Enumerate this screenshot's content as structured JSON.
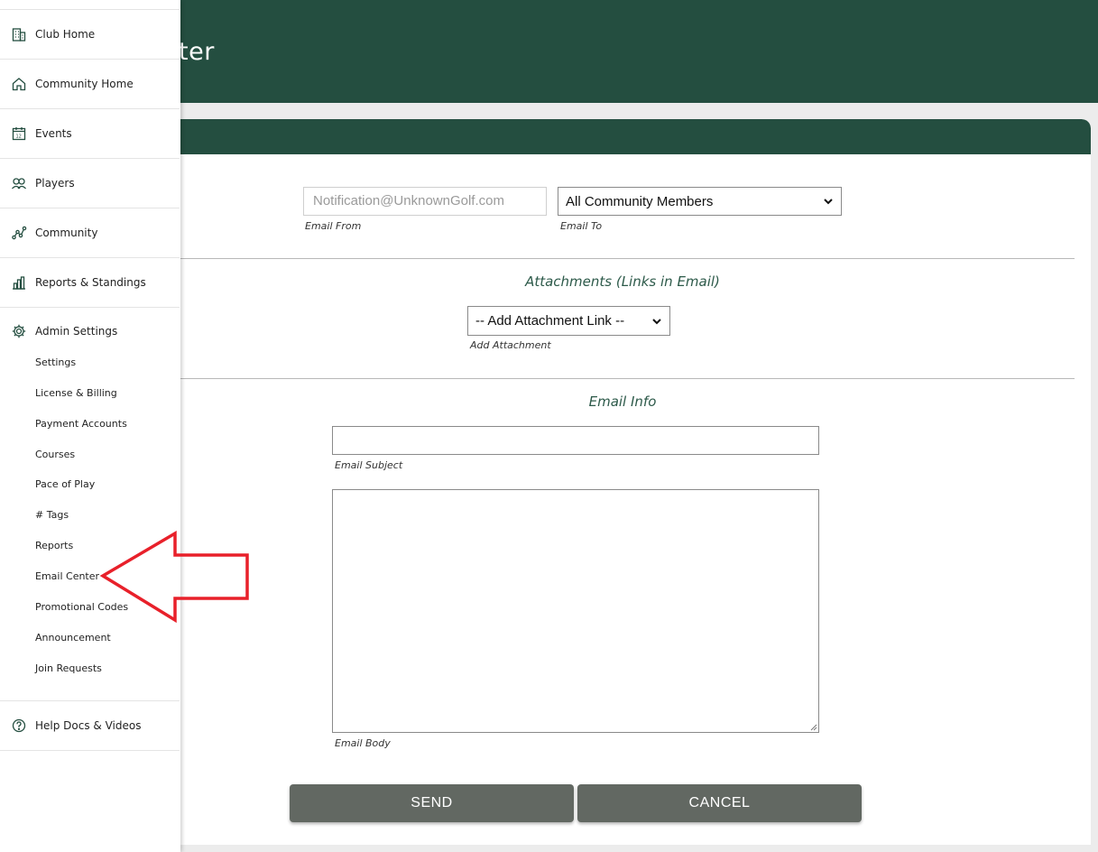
{
  "header": {
    "title": "ter"
  },
  "sidebar": {
    "items": [
      {
        "label": "Club Home",
        "icon": "building-icon"
      },
      {
        "label": "Community Home",
        "icon": "home-icon"
      },
      {
        "label": "Events",
        "icon": "calendar-icon"
      },
      {
        "label": "Players",
        "icon": "players-icon"
      },
      {
        "label": "Community",
        "icon": "network-icon"
      },
      {
        "label": "Reports & Standings",
        "icon": "bar-chart-icon"
      }
    ],
    "admin": {
      "label": "Admin Settings",
      "icon": "gear-icon",
      "subitems": [
        "Settings",
        "License & Billing",
        "Payment Accounts",
        "Courses",
        "Pace of Play",
        "# Tags",
        "Reports",
        "Email Center",
        "Promotional Codes",
        "Announcement",
        "Join Requests"
      ]
    },
    "help": {
      "label": "Help Docs & Videos",
      "icon": "help-circle-icon"
    }
  },
  "form": {
    "email_from": {
      "placeholder": "Notification@UnknownGolf.com",
      "label": "Email From"
    },
    "email_to": {
      "value": "All Community Members",
      "label": "Email To"
    },
    "attachments": {
      "title": "Attachments (Links in Email)",
      "select_value": "-- Add Attachment Link --",
      "label": "Add Attachment"
    },
    "email_info": {
      "title": "Email Info",
      "subject_label": "Email Subject",
      "body_label": "Email Body"
    },
    "buttons": {
      "send": "SEND",
      "cancel": "CANCEL"
    }
  },
  "colors": {
    "brand_green": "#244e40",
    "button_gray": "#626862",
    "arrow_red": "#e8202a"
  }
}
